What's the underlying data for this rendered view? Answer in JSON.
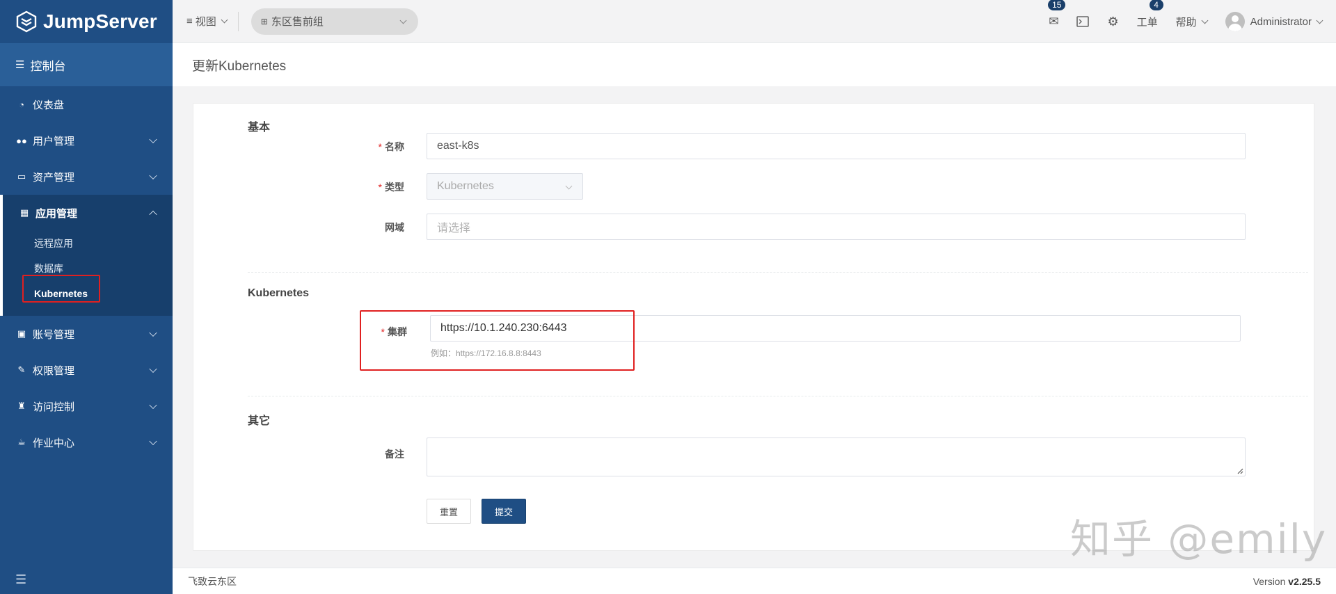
{
  "brand": {
    "name": "JumpServer"
  },
  "sidebar": {
    "console_label": "控制台",
    "items": [
      {
        "label": "仪表盘",
        "icon": "dashboard-icon"
      },
      {
        "label": "用户管理",
        "icon": "users-icon"
      },
      {
        "label": "资产管理",
        "icon": "inbox-icon"
      },
      {
        "label": "应用管理",
        "icon": "grid-icon"
      },
      {
        "label": "账号管理",
        "icon": "id-card-icon"
      },
      {
        "label": "权限管理",
        "icon": "edit-icon"
      },
      {
        "label": "访问控制",
        "icon": "castle-icon"
      },
      {
        "label": "作业中心",
        "icon": "coffee-icon"
      }
    ],
    "sub_items": [
      "远程应用",
      "数据库",
      "Kubernetes"
    ],
    "active_sub": "Kubernetes"
  },
  "topbar": {
    "view_label": "视图",
    "org_label": "东区售前组",
    "mail_badge": "15",
    "ticket_label": "工单",
    "ticket_badge": "4",
    "help_label": "帮助",
    "user_name": "Administrator"
  },
  "page": {
    "title": "更新Kubernetes"
  },
  "form": {
    "section_basic": "基本",
    "name_label": "名称",
    "name_value": "east-k8s",
    "type_label": "类型",
    "type_value": "Kubernetes",
    "domain_label": "网域",
    "domain_placeholder": "请选择",
    "section_k8s": "Kubernetes",
    "cluster_label": "集群",
    "cluster_value": "https://10.1.240.230:6443",
    "cluster_hint": "例如：https://172.16.8.8:8443",
    "section_other": "其它",
    "comment_label": "备注",
    "reset_label": "重置",
    "submit_label": "提交",
    "required_mark": "*"
  },
  "watermark": "知乎 @emily",
  "footer": {
    "org": "飞致云东区",
    "version_prefix": "Version ",
    "version": "v2.25.5"
  },
  "colors": {
    "sidebar": "#1f4e84",
    "accent": "#1f4e84",
    "highlight": "#e02020"
  }
}
